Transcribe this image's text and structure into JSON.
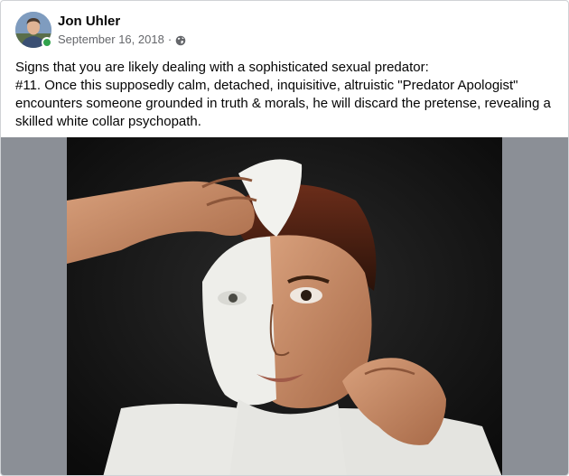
{
  "post": {
    "author": "Jon Uhler",
    "date": "September 16, 2018",
    "separator": "·",
    "privacy_icon": "globe-icon",
    "text_lines": [
      "Signs that you are likely dealing with a sophisticated sexual predator:",
      "#11. Once this supposedly calm, detached, inquisitive, altruistic \"Predator Apologist\"",
      "encounters someone grounded in truth & morals, he will discard the pretense, revealing a",
      "skilled white collar psychopath."
    ]
  },
  "colors": {
    "online": "#31a24c",
    "secondary_text": "#65676b",
    "media_background": "#8b8f96"
  }
}
